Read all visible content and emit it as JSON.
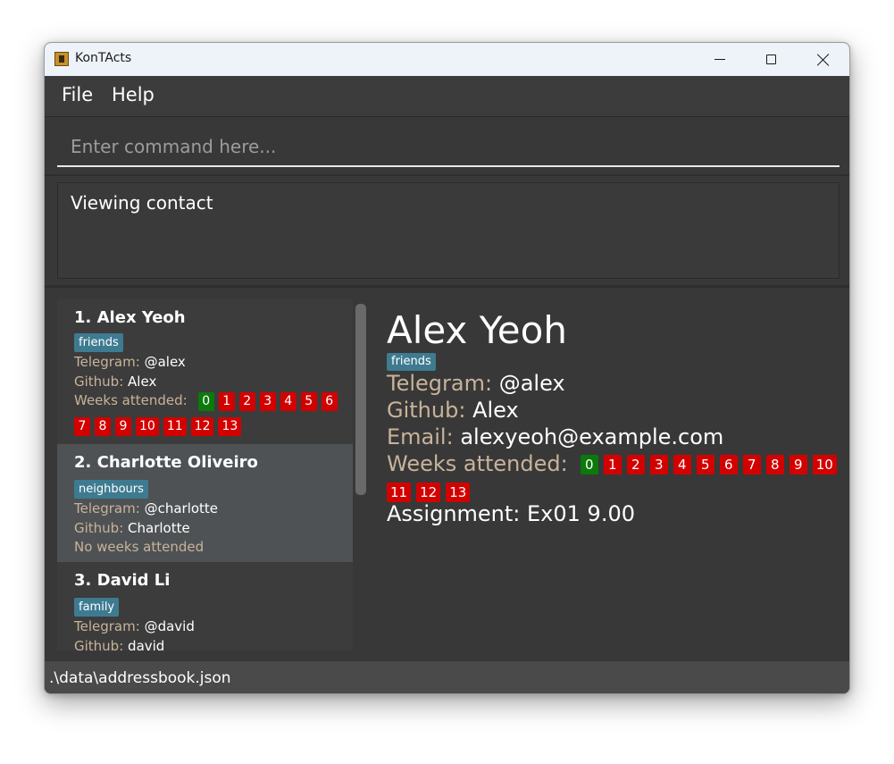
{
  "window": {
    "title": "KonTActs"
  },
  "menu": {
    "file": "File",
    "help": "Help"
  },
  "command": {
    "placeholder": "Enter command here..."
  },
  "result": {
    "text": "Viewing contact"
  },
  "contacts": [
    {
      "name": "1. Alex Yeoh",
      "tag": "friends",
      "telegram_label": "Telegram:",
      "telegram": "@alex",
      "github_label": "Github:",
      "github": "Alex",
      "weeks_label": "Weeks attended:",
      "weeks_row1": [
        "0",
        "1",
        "2",
        "3",
        "4",
        "5",
        "6"
      ],
      "weeks_row2": [
        "7",
        "8",
        "9",
        "10",
        "11",
        "12",
        "13"
      ]
    },
    {
      "name": "2. Charlotte Oliveiro",
      "tag": "neighbours",
      "telegram_label": "Telegram:",
      "telegram": "@charlotte",
      "github_label": "Github:",
      "github": "Charlotte",
      "weeks_text": "No weeks attended"
    },
    {
      "name": "3. David Li",
      "tag": "family",
      "telegram_label": "Telegram:",
      "telegram": "@david",
      "github_label": "Github:",
      "github": "david"
    }
  ],
  "detail": {
    "name": "Alex Yeoh",
    "tag": "friends",
    "telegram_label": "Telegram:",
    "telegram": "@alex",
    "github_label": "Github:",
    "github": "Alex",
    "email_label": "Email:",
    "email": "alexyeoh@example.com",
    "weeks_label": "Weeks attended:",
    "weeks_row1": [
      "0",
      "1",
      "2",
      "3",
      "4",
      "5",
      "6",
      "7",
      "8",
      "9",
      "10"
    ],
    "weeks_row2": [
      "11",
      "12",
      "13"
    ],
    "assignment": "Assignment: Ex01 9.00"
  },
  "status": {
    "path": ".\\data\\addressbook.json"
  },
  "colors": {
    "present": "#0b7a0b",
    "absent": "#d30000",
    "tag": "#3e7b91",
    "label": "#c8b39a"
  }
}
